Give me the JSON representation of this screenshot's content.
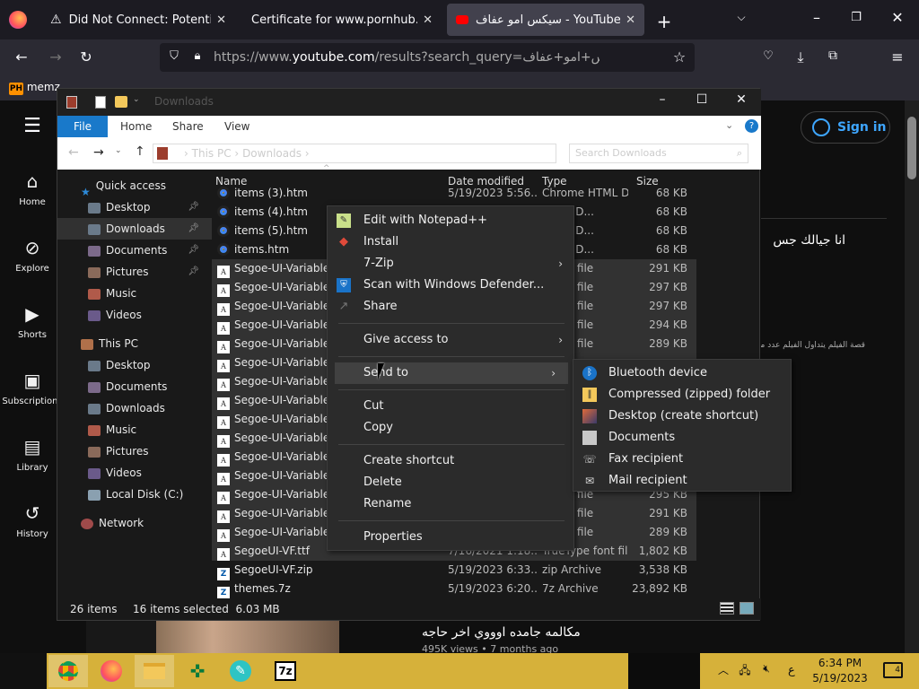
{
  "browser": {
    "tabs": [
      {
        "title": "Did Not Connect: Potential Se",
        "icon": "warning-icon"
      },
      {
        "title": "Certificate for www.pornhub.com",
        "icon": "certificate-icon"
      },
      {
        "title": "سيكس امو عفاف - YouTube",
        "icon": "youtube-icon"
      }
    ],
    "url_prefix": "https://www.",
    "url_domain": "youtube.com",
    "url_rest": "/results?search_query=سيكس+امو+عفاف",
    "bookmark": "memz"
  },
  "youtube": {
    "sidebar": [
      {
        "label": "Home",
        "icon": "home-icon"
      },
      {
        "label": "Explore",
        "icon": "compass-icon"
      },
      {
        "label": "Shorts",
        "icon": "shorts-icon"
      },
      {
        "label": "Subscriptions",
        "icon": "subscriptions-icon"
      },
      {
        "label": "Library",
        "icon": "library-icon"
      },
      {
        "label": "History",
        "icon": "history-icon"
      }
    ],
    "sign_in": "Sign in",
    "result_title_1": "انا جيالك جس",
    "result_desc_1": "قصة الفيلم يتداول الفيلم عدد من",
    "result_title_2": "مكالمه جامده اوووي اخر حاجه",
    "result_meta_2": "495K views • 7 months ago"
  },
  "explorer": {
    "title": "Downloads",
    "ribbon_tabs": [
      "File",
      "Home",
      "Share",
      "View"
    ],
    "breadcrumb": [
      "This PC",
      "Downloads"
    ],
    "search_placeholder": "Search Downloads",
    "columns": [
      "Name",
      "Date modified",
      "Type",
      "Size"
    ],
    "nav": [
      {
        "label": "Quick access",
        "pin": false
      },
      {
        "label": "Desktop",
        "pin": true
      },
      {
        "label": "Downloads",
        "pin": true
      },
      {
        "label": "Documents",
        "pin": true
      },
      {
        "label": "Pictures",
        "pin": true
      },
      {
        "label": "Music",
        "pin": false
      },
      {
        "label": "Videos",
        "pin": false
      },
      {
        "label": "This PC",
        "pin": false
      },
      {
        "label": "Desktop",
        "pin": false
      },
      {
        "label": "Documents",
        "pin": false
      },
      {
        "label": "Downloads",
        "pin": false
      },
      {
        "label": "Music",
        "pin": false
      },
      {
        "label": "Pictures",
        "pin": false
      },
      {
        "label": "Videos",
        "pin": false
      },
      {
        "label": "Local Disk (C:)",
        "pin": false
      },
      {
        "label": "Network",
        "pin": false
      }
    ],
    "files": [
      {
        "name": "items (3).htm",
        "date": "5/19/2023 5:56...",
        "type": "Chrome HTML D...",
        "size": "68 KB",
        "icon": "chrome",
        "sel": false
      },
      {
        "name": "items (4).htm",
        "date": "",
        "type": "HTML D...",
        "size": "68 KB",
        "icon": "chrome",
        "sel": false
      },
      {
        "name": "items (5).htm",
        "date": "",
        "type": "HTML D...",
        "size": "68 KB",
        "icon": "chrome",
        "sel": false
      },
      {
        "name": "items.htm",
        "date": "",
        "type": "HTML D...",
        "size": "68 KB",
        "icon": "chrome",
        "sel": false
      },
      {
        "name": "Segoe-UI-Variable-Sta",
        "date": "",
        "type": "e font file",
        "size": "291 KB",
        "icon": "font",
        "sel": true
      },
      {
        "name": "Segoe-UI-Variable-Sta",
        "date": "",
        "type": "e font file",
        "size": "297 KB",
        "icon": "font",
        "sel": true
      },
      {
        "name": "Segoe-UI-Variable-Sta",
        "date": "",
        "type": "e font file",
        "size": "297 KB",
        "icon": "font",
        "sel": true
      },
      {
        "name": "Segoe-UI-Variable-Sta",
        "date": "",
        "type": "e font file",
        "size": "294 KB",
        "icon": "font",
        "sel": true
      },
      {
        "name": "Segoe-UI-Variable-Sta",
        "date": "",
        "type": "e font file",
        "size": "289 KB",
        "icon": "font",
        "sel": true
      },
      {
        "name": "Segoe-UI-Variable-Sta",
        "date": "",
        "type": "",
        "size": "",
        "icon": "font",
        "sel": true
      },
      {
        "name": "Segoe-UI-Variable-Sta",
        "date": "",
        "type": "",
        "size": "",
        "icon": "font",
        "sel": true
      },
      {
        "name": "Segoe-UI-Variable-Sta",
        "date": "",
        "type": "",
        "size": "",
        "icon": "font",
        "sel": true
      },
      {
        "name": "Segoe-UI-Variable-Sta",
        "date": "",
        "type": "",
        "size": "",
        "icon": "font",
        "sel": true
      },
      {
        "name": "Segoe-UI-Variable-Sta",
        "date": "",
        "type": "",
        "size": "",
        "icon": "font",
        "sel": true
      },
      {
        "name": "Segoe-UI-Variable-Sta",
        "date": "",
        "type": "",
        "size": "",
        "icon": "font",
        "sel": true
      },
      {
        "name": "Segoe-UI-Variable-Sta",
        "date": "",
        "type": "",
        "size": "",
        "icon": "font",
        "sel": true
      },
      {
        "name": "Segoe-UI-Variable-Sta",
        "date": "",
        "type": "e font file",
        "size": "295 KB",
        "icon": "font",
        "sel": true
      },
      {
        "name": "Segoe-UI-Variable-Sta",
        "date": "",
        "type": "e font file",
        "size": "291 KB",
        "icon": "font",
        "sel": true
      },
      {
        "name": "Segoe-UI-Variable-Sta",
        "date": "",
        "type": "e font file",
        "size": "289 KB",
        "icon": "font",
        "sel": true
      },
      {
        "name": "SegoeUI-VF.ttf",
        "date": "7/16/2021 1:18...",
        "type": "TrueType font file",
        "size": "1,802 KB",
        "icon": "font",
        "sel": true
      },
      {
        "name": "SegoeUI-VF.zip",
        "date": "5/19/2023 6:33...",
        "type": "zip Archive",
        "size": "3,538 KB",
        "icon": "zip",
        "sel": false
      },
      {
        "name": "themes.7z",
        "date": "5/19/2023 6:20...",
        "type": "7z Archive",
        "size": "23,892 KB",
        "icon": "zip",
        "sel": false
      }
    ],
    "status_items": "26 items",
    "status_selected": "16 items selected  6.03 MB"
  },
  "context_menu": {
    "items": [
      {
        "label": "Edit with Notepad++",
        "icon": "notepad-plus-icon",
        "arrow": false
      },
      {
        "label": "Install",
        "icon": "shield-icon",
        "arrow": false
      },
      {
        "label": "7-Zip",
        "icon": "",
        "arrow": true
      },
      {
        "label": "Scan with Windows Defender...",
        "icon": "defender-icon",
        "arrow": false
      },
      {
        "label": "Share",
        "icon": "share-icon",
        "arrow": false
      },
      {
        "label": "Give access to",
        "icon": "",
        "arrow": true
      },
      {
        "label": "Send to",
        "icon": "",
        "arrow": true
      },
      {
        "label": "Cut",
        "icon": "",
        "arrow": false
      },
      {
        "label": "Copy",
        "icon": "",
        "arrow": false
      },
      {
        "label": "Create shortcut",
        "icon": "",
        "arrow": false
      },
      {
        "label": "Delete",
        "icon": "",
        "arrow": false
      },
      {
        "label": "Rename",
        "icon": "",
        "arrow": false
      },
      {
        "label": "Properties",
        "icon": "",
        "arrow": false
      }
    ],
    "send_to": [
      {
        "label": "Bluetooth device",
        "icon": "bluetooth-icon"
      },
      {
        "label": "Compressed (zipped) folder",
        "icon": "zip-folder-icon"
      },
      {
        "label": "Desktop (create shortcut)",
        "icon": "desktop-icon"
      },
      {
        "label": "Documents",
        "icon": "documents-icon"
      },
      {
        "label": "Fax recipient",
        "icon": "fax-icon"
      },
      {
        "label": "Mail recipient",
        "icon": "mail-icon"
      }
    ]
  },
  "taskbar": {
    "apps": [
      "chrome-icon",
      "firefox-icon",
      "file-explorer-icon",
      "app-icon",
      "paint-icon",
      "7zip-icon"
    ],
    "lang": "ع",
    "time": "6:34 PM",
    "date": "5/19/2023",
    "notif_count": "4"
  }
}
